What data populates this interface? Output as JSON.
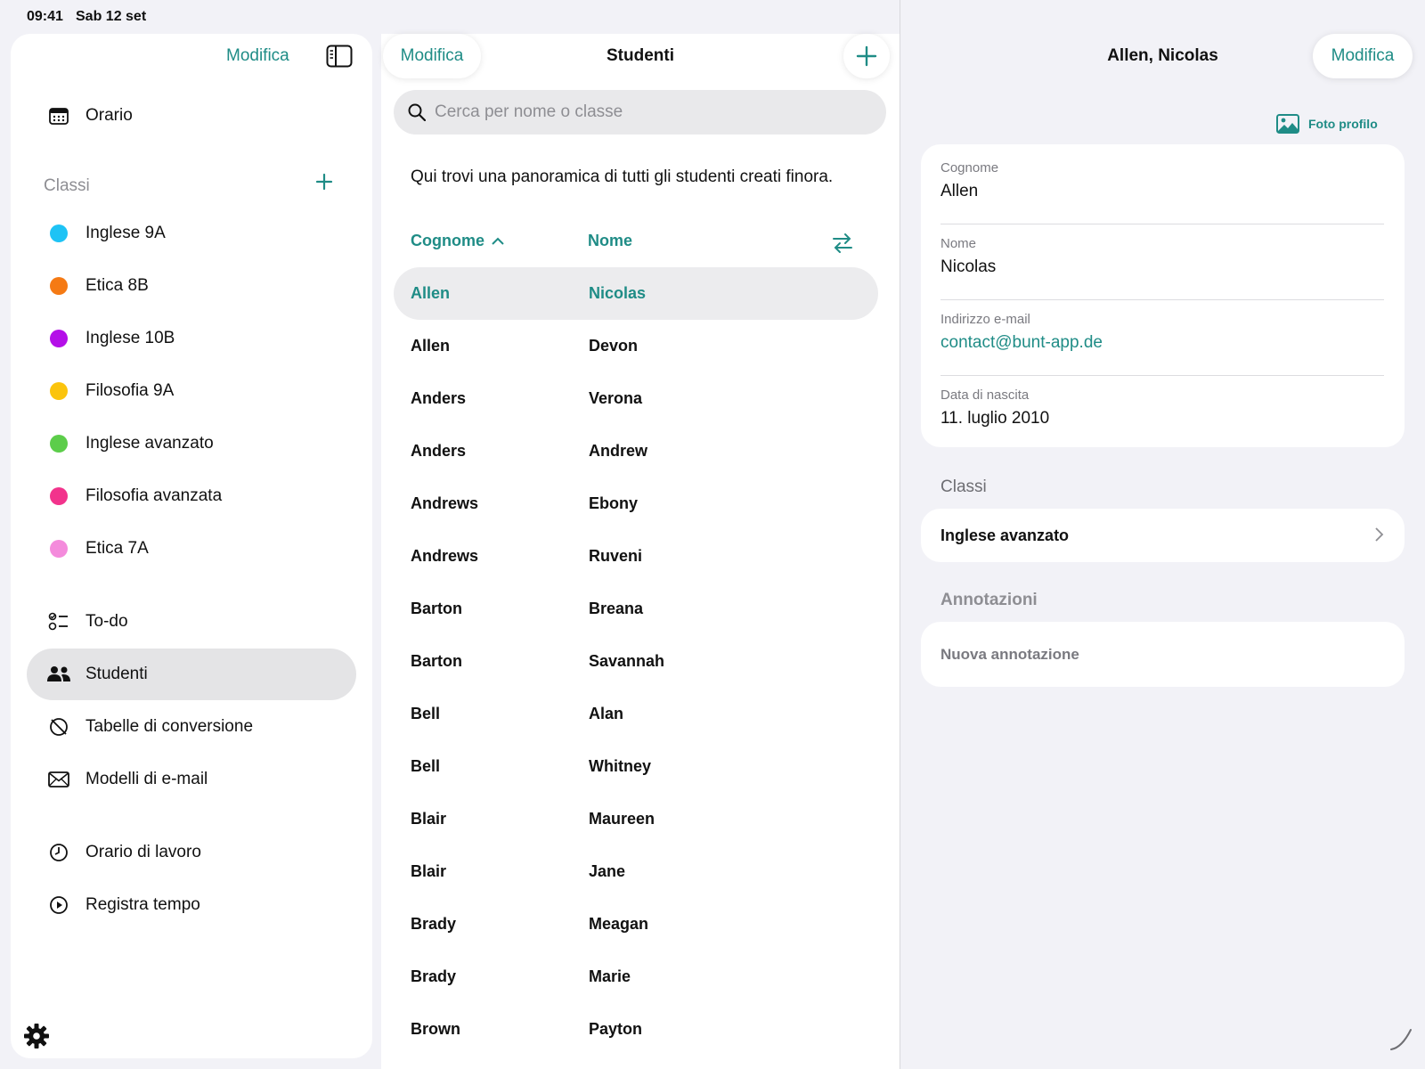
{
  "status": {
    "time": "09:41",
    "date": "Sab 12 set"
  },
  "sidebar": {
    "edit_label": "Modifica",
    "orario": "Orario",
    "classes_header": "Classi",
    "classes": [
      {
        "label": "Inglese 9A",
        "color": "#1ec3f5"
      },
      {
        "label": "Etica 8B",
        "color": "#f57a14"
      },
      {
        "label": "Inglese 10B",
        "color": "#b40fe8"
      },
      {
        "label": "Filosofia 9A",
        "color": "#fbc40d"
      },
      {
        "label": "Inglese avanzato",
        "color": "#5ccd4a"
      },
      {
        "label": "Filosofia avanzata",
        "color": "#f2338c"
      },
      {
        "label": "Etica 7A",
        "color": "#f48bdc"
      }
    ],
    "nav": {
      "todo": "To-do",
      "studenti": "Studenti",
      "tabelle": "Tabelle di conversione",
      "modelli": "Modelli di e-mail",
      "orario_lavoro": "Orario di lavoro",
      "registra": "Registra tempo"
    }
  },
  "students": {
    "edit_label": "Modifica",
    "title": "Studenti",
    "search_placeholder": "Cerca per nome o classe",
    "intro": "Qui trovi una panoramica di tutti gli studenti creati finora.",
    "col_lastname": "Cognome",
    "col_firstname": "Nome",
    "rows": [
      {
        "last": "Allen",
        "first": "Nicolas"
      },
      {
        "last": "Allen",
        "first": "Devon"
      },
      {
        "last": "Anders",
        "first": "Verona"
      },
      {
        "last": "Anders",
        "first": "Andrew"
      },
      {
        "last": "Andrews",
        "first": "Ebony"
      },
      {
        "last": "Andrews",
        "first": "Ruveni"
      },
      {
        "last": "Barton",
        "first": "Breana"
      },
      {
        "last": "Barton",
        "first": "Savannah"
      },
      {
        "last": "Bell",
        "first": "Alan"
      },
      {
        "last": "Bell",
        "first": "Whitney"
      },
      {
        "last": "Blair",
        "first": "Maureen"
      },
      {
        "last": "Blair",
        "first": "Jane"
      },
      {
        "last": "Brady",
        "first": "Meagan"
      },
      {
        "last": "Brady",
        "first": "Marie"
      },
      {
        "last": "Brown",
        "first": "Payton"
      }
    ]
  },
  "detail": {
    "title": "Allen, Nicolas",
    "edit_label": "Modifica",
    "photo_label": "Foto profilo",
    "fields": {
      "cognome_label": "Cognome",
      "cognome": "Allen",
      "nome_label": "Nome",
      "nome": "Nicolas",
      "email_label": "Indirizzo e-mail",
      "email": "contact@bunt-app.de",
      "nascita_label": "Data di nascita",
      "nascita": "11. luglio 2010"
    },
    "classes_header": "Classi",
    "class_item": "Inglese avanzato",
    "notes_header": "Annotazioni",
    "new_note": "Nuova annotazione"
  },
  "colors": {
    "accent": "#1f8c86"
  }
}
